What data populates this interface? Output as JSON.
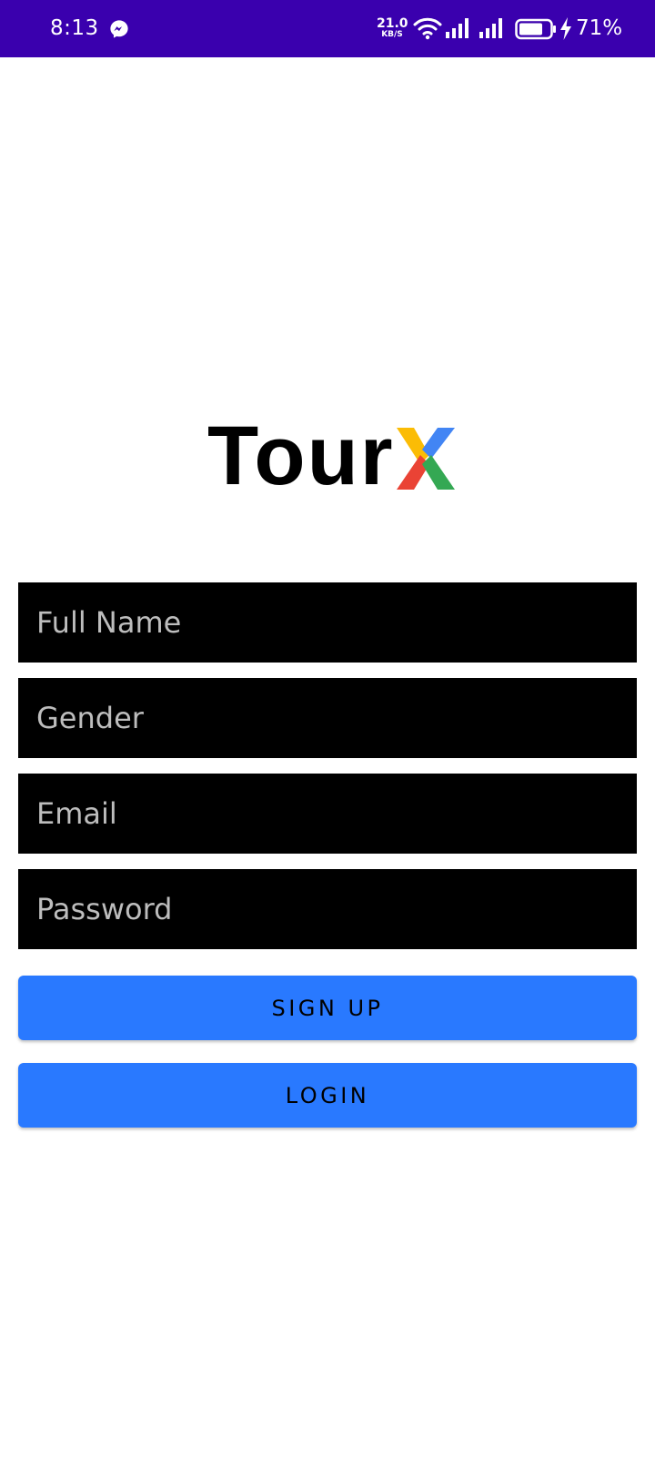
{
  "status_bar": {
    "time": "8:13",
    "net_speed_value": "21.0",
    "net_speed_unit": "KB/S",
    "battery_percent": "71%",
    "icons": [
      "messenger-icon",
      "wifi-icon",
      "signal-icon",
      "signal-icon",
      "battery-icon",
      "charging-icon"
    ],
    "background_color": "#3a00ae"
  },
  "logo": {
    "text": "Tour",
    "x_colors": [
      "#fbbc05",
      "#4285f4",
      "#ea4335",
      "#34a853"
    ]
  },
  "form": {
    "full_name": {
      "placeholder": "Full Name",
      "value": ""
    },
    "gender": {
      "placeholder": "Gender",
      "value": ""
    },
    "email": {
      "placeholder": "Email",
      "value": ""
    },
    "password": {
      "placeholder": "Password",
      "value": ""
    }
  },
  "buttons": {
    "sign_up": "SIGN UP",
    "login": "LOGIN",
    "color": "#2979ff"
  }
}
